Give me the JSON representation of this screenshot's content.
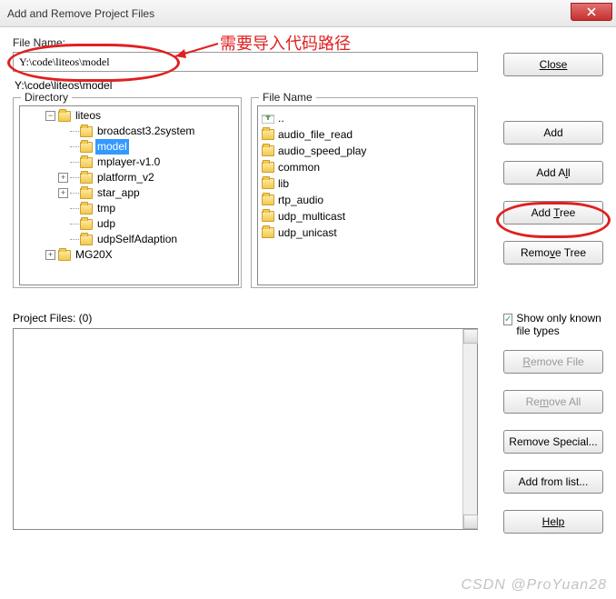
{
  "window": {
    "title": "Add and Remove Project Files"
  },
  "labels": {
    "file_name": "File Name:",
    "directory_panel": "Directory",
    "filename_panel": "File Name",
    "project_files": "Project Files: (0)",
    "show_known": "Show only known file types"
  },
  "input": {
    "path_value": "Y:\\code\\liteos\\model",
    "path_echo": "Y:\\code\\liteos\\model"
  },
  "tree": {
    "root": "liteos",
    "items": [
      {
        "label": "broadcast3.2system",
        "exp": ""
      },
      {
        "label": "model",
        "exp": "",
        "selected": true
      },
      {
        "label": "mplayer-v1.0",
        "exp": ""
      },
      {
        "label": "platform_v2",
        "exp": "+"
      },
      {
        "label": "star_app",
        "exp": "+"
      },
      {
        "label": "tmp",
        "exp": ""
      },
      {
        "label": "udp",
        "exp": ""
      },
      {
        "label": "udpSelfAdaption",
        "exp": ""
      }
    ],
    "after": "MG20X",
    "after_exp": "+"
  },
  "files": {
    "up": "..",
    "items": [
      "audio_file_read",
      "audio_speed_play",
      "common",
      "lib",
      "rtp_audio",
      "udp_multicast",
      "udp_unicast"
    ]
  },
  "buttons": {
    "close": "Close",
    "add": "Add",
    "add_all": "Add All",
    "add_tree": "Add Tree",
    "remove_tree": "Remove Tree",
    "remove_file": "Remove File",
    "remove_all": "Remove All",
    "remove_special": "Remove Special...",
    "add_from_list": "Add from list...",
    "help": "Help"
  },
  "annotation": {
    "text": "需要导入代码路径"
  },
  "watermark": "CSDN @ProYuan28"
}
